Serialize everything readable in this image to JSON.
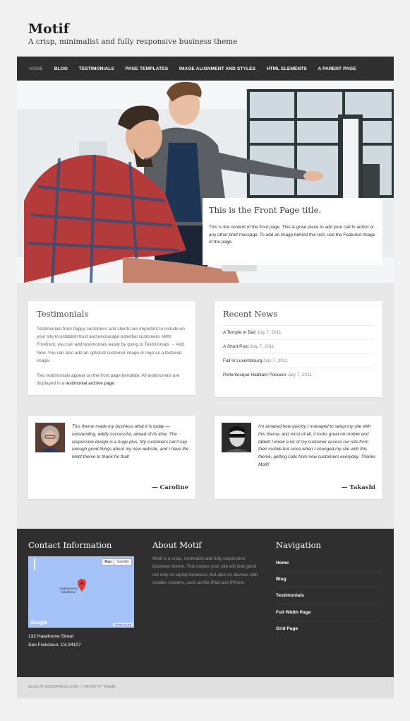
{
  "site": {
    "title": "Motif",
    "description": "A crisp, minimalist and fully responsive business theme"
  },
  "nav": [
    {
      "label": "Home",
      "current": true
    },
    {
      "label": "Blog"
    },
    {
      "label": "Testimonials"
    },
    {
      "label": "Page Templates"
    },
    {
      "label": "Image Alignment and Styles"
    },
    {
      "label": "HTML Elements"
    },
    {
      "label": "A Parent Page"
    }
  ],
  "hero": {
    "title": "This is the Front Page title.",
    "text_1": "This is the content of the front page. This is great place to add your ",
    "text_em": "call to action",
    "text_2": " or any other brief message. To add an image behind this text, use the Featured Image of the page."
  },
  "testimonials_widget": {
    "heading": "Testimonials",
    "para1": "Testimonials from happy customers and clients are important to include on your site to establish trust and encourage potential customers. With Forefront, you can add testimonials easily by going to Testimonials → Add New. You can also add an optional customer image or logo as a featured image.",
    "para2_a": "Two testimonials appear on the front page template. All testimonials are displayed in a ",
    "para2_link": "testimonial archive page",
    "para2_b": "."
  },
  "recent_news": {
    "heading": "Recent News",
    "items": [
      {
        "title": "A Temple in Bali",
        "date": "July 7, 2011"
      },
      {
        "title": "A Short Post",
        "date": "July 7, 2011"
      },
      {
        "title": "Fall in Luxembourg",
        "date": "July 7, 2011"
      },
      {
        "title": "Pellentesque Habitant Posuere",
        "date": "July 7, 2011"
      }
    ]
  },
  "testimonials": [
    {
      "quote": "This theme made my business what it is today — outstanding, wildly successful, ahead of its time. The responsive design is a huge plus. My customers can't say enough good things about my new website, and I have the Motif theme to thank for that!",
      "author": "— Caroline"
    },
    {
      "quote": "I'm amazed how quickly I managed to setup my site with this theme, and most of all, it looks great on mobile and tablet! I knew a lot of my customer access our site from their mobile but since when I changed my site with this theme, getting calls from new customers everyday. Thanks Motif!",
      "author": "— Takashi"
    }
  ],
  "footer": {
    "contact_heading": "Contact Information",
    "map": {
      "btn_map": "Map",
      "btn_satellite": "Satellite",
      "place_line1": "Apartamento",
      "place_line2": "Sandhone",
      "logo": "Google",
      "terms": "Terms of Use"
    },
    "address_line1": "132 Hawthorne Street",
    "address_line2": "San Francisco, CA 94107",
    "about_heading": "About Motif",
    "about_text": "Motif is a crisp, minimalist and fully responsive business theme. This means your site will look good not only on laptop browsers, but also on devices with smaller screens, such as the iPad and iPhone.",
    "nav_heading": "Navigation",
    "nav_items": [
      "Home",
      "Blog",
      "Testimonials",
      "Full Width Page",
      "Grid Page"
    ]
  },
  "credits": "Blog at WordPress.com. | The Motif Theme."
}
